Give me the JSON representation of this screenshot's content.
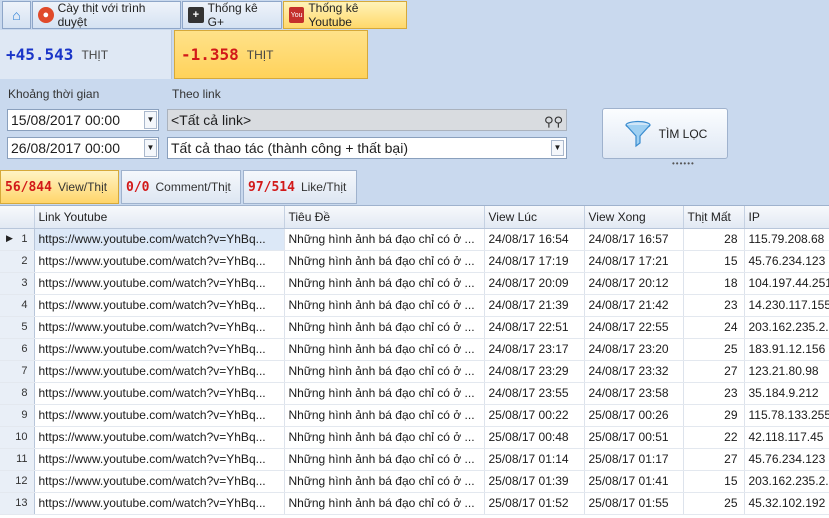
{
  "tabs": [
    {
      "icon": "home-icon",
      "label": ""
    },
    {
      "icon": "browser-icon",
      "label": "Cày thịt với trình duyệt"
    },
    {
      "icon": "gplus-icon",
      "label": "Thống kê G+"
    },
    {
      "icon": "youtube-icon",
      "label": "Thống kê Youtube"
    }
  ],
  "stats": {
    "positive": "+45.543",
    "positive_unit": "THỊT",
    "negative": "-1.358",
    "negative_unit": "THỊT"
  },
  "filters": {
    "time_label": "Khoảng thời gian",
    "from_date": "15/08/2017 00:00",
    "to_date": "26/08/2017 00:00",
    "link_label": "Theo link",
    "link_value": "<Tất cả link>",
    "action_value": "Tất cả thao tác (thành công + thất bại)",
    "filter_button": "TÌM LỌC"
  },
  "subtabs": [
    {
      "count": "56/844",
      "label": "View/Thịt"
    },
    {
      "count": "0/0",
      "label": "Comment/Thịt"
    },
    {
      "count": "97/514",
      "label": "Like/Thịt"
    }
  ],
  "table": {
    "columns": [
      "Link Youtube",
      "Tiêu Đề",
      "View Lúc",
      "View Xong",
      "Thịt Mất",
      "IP"
    ],
    "rows": [
      {
        "n": "1",
        "link": "https://www.youtube.com/watch?v=YhBq...",
        "title": "Những hình ảnh bá đạo chỉ có ở ...",
        "start": "24/08/17 16:54",
        "end": "24/08/17 16:57",
        "cost": "28",
        "ip": "115.79.208.68"
      },
      {
        "n": "2",
        "link": "https://www.youtube.com/watch?v=YhBq...",
        "title": "Những hình ảnh bá đạo chỉ có ở ...",
        "start": "24/08/17 17:19",
        "end": "24/08/17 17:21",
        "cost": "15",
        "ip": "45.76.234.123"
      },
      {
        "n": "3",
        "link": "https://www.youtube.com/watch?v=YhBq...",
        "title": "Những hình ảnh bá đạo chỉ có ở ...",
        "start": "24/08/17 20:09",
        "end": "24/08/17 20:12",
        "cost": "18",
        "ip": "104.197.44.251"
      },
      {
        "n": "4",
        "link": "https://www.youtube.com/watch?v=YhBq...",
        "title": "Những hình ảnh bá đạo chỉ có ở ...",
        "start": "24/08/17 21:39",
        "end": "24/08/17 21:42",
        "cost": "23",
        "ip": "14.230.117.155"
      },
      {
        "n": "5",
        "link": "https://www.youtube.com/watch?v=YhBq...",
        "title": "Những hình ảnh bá đạo chỉ có ở ...",
        "start": "24/08/17 22:51",
        "end": "24/08/17 22:55",
        "cost": "24",
        "ip": "203.162.235.2..."
      },
      {
        "n": "6",
        "link": "https://www.youtube.com/watch?v=YhBq...",
        "title": "Những hình ảnh bá đạo chỉ có ở ...",
        "start": "24/08/17 23:17",
        "end": "24/08/17 23:20",
        "cost": "25",
        "ip": "183.91.12.156"
      },
      {
        "n": "7",
        "link": "https://www.youtube.com/watch?v=YhBq...",
        "title": "Những hình ảnh bá đạo chỉ có ở ...",
        "start": "24/08/17 23:29",
        "end": "24/08/17 23:32",
        "cost": "27",
        "ip": "123.21.80.98"
      },
      {
        "n": "8",
        "link": "https://www.youtube.com/watch?v=YhBq...",
        "title": "Những hình ảnh bá đạo chỉ có ở ...",
        "start": "24/08/17 23:55",
        "end": "24/08/17 23:58",
        "cost": "23",
        "ip": "35.184.9.212"
      },
      {
        "n": "9",
        "link": "https://www.youtube.com/watch?v=YhBq...",
        "title": "Những hình ảnh bá đạo chỉ có ở ...",
        "start": "25/08/17 00:22",
        "end": "25/08/17 00:26",
        "cost": "29",
        "ip": "115.78.133.255"
      },
      {
        "n": "10",
        "link": "https://www.youtube.com/watch?v=YhBq...",
        "title": "Những hình ảnh bá đạo chỉ có ở ...",
        "start": "25/08/17 00:48",
        "end": "25/08/17 00:51",
        "cost": "22",
        "ip": "42.118.117.45"
      },
      {
        "n": "11",
        "link": "https://www.youtube.com/watch?v=YhBq...",
        "title": "Những hình ảnh bá đạo chỉ có ở ...",
        "start": "25/08/17 01:14",
        "end": "25/08/17 01:17",
        "cost": "27",
        "ip": "45.76.234.123"
      },
      {
        "n": "12",
        "link": "https://www.youtube.com/watch?v=YhBq...",
        "title": "Những hình ảnh bá đạo chỉ có ở ...",
        "start": "25/08/17 01:39",
        "end": "25/08/17 01:41",
        "cost": "15",
        "ip": "203.162.235.2..."
      },
      {
        "n": "13",
        "link": "https://www.youtube.com/watch?v=YhBq...",
        "title": "Những hình ảnh bá đạo chỉ có ở ...",
        "start": "25/08/17 01:52",
        "end": "25/08/17 01:55",
        "cost": "25",
        "ip": "45.32.102.192"
      }
    ]
  }
}
